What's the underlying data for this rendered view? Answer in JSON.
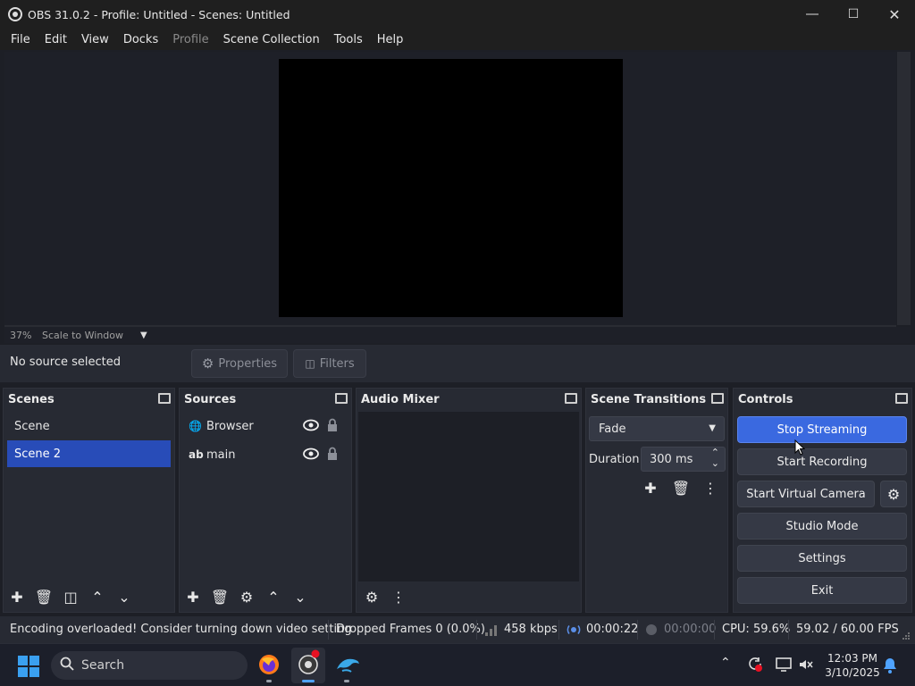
{
  "window": {
    "title": "OBS 31.0.2 - Profile: Untitled - Scenes: Untitled"
  },
  "menu": [
    {
      "label": "File",
      "disabled": false
    },
    {
      "label": "Edit",
      "disabled": false
    },
    {
      "label": "View",
      "disabled": false
    },
    {
      "label": "Docks",
      "disabled": false
    },
    {
      "label": "Profile",
      "disabled": true
    },
    {
      "label": "Scene Collection",
      "disabled": false
    },
    {
      "label": "Tools",
      "disabled": false
    },
    {
      "label": "Help",
      "disabled": false
    }
  ],
  "preview": {
    "zoom": "37%",
    "scale_mode": "Scale to Window"
  },
  "source_bar": {
    "status": "No source selected",
    "properties": "Properties",
    "filters": "Filters"
  },
  "scenes": {
    "title": "Scenes",
    "items": [
      "Scene",
      "Scene 2"
    ],
    "selected": 1
  },
  "sources": {
    "title": "Sources",
    "items": [
      {
        "name": "Browser",
        "icon": "globe-icon"
      },
      {
        "name": "main",
        "icon": "text-icon",
        "icon_text": "ab"
      }
    ]
  },
  "audio_mixer": {
    "title": "Audio Mixer"
  },
  "transitions": {
    "title": "Scene Transitions",
    "selected": "Fade",
    "duration_label": "Duration",
    "duration_value": "300 ms"
  },
  "controls": {
    "title": "Controls",
    "stop_streaming": "Stop Streaming",
    "start_recording": "Start Recording",
    "start_virtual_camera": "Start Virtual Camera",
    "studio_mode": "Studio Mode",
    "settings": "Settings",
    "exit": "Exit"
  },
  "status": {
    "message": "Encoding overloaded! Consider turning down video setting",
    "dropped_frames": "Dropped Frames 0 (0.0%)",
    "bitrate": "458 kbps",
    "stream_time": "00:00:22",
    "record_time": "00:00:00",
    "cpu": "CPU: 59.6%",
    "fps": "59.02 / 60.00 FPS"
  },
  "taskbar": {
    "search_placeholder": "Search",
    "time": "12:03 PM",
    "date": "3/10/2025"
  },
  "colors": {
    "accent": "#3a69e0",
    "selected": "#284cb8",
    "panel": "#272a33",
    "background": "#1d1f26"
  }
}
